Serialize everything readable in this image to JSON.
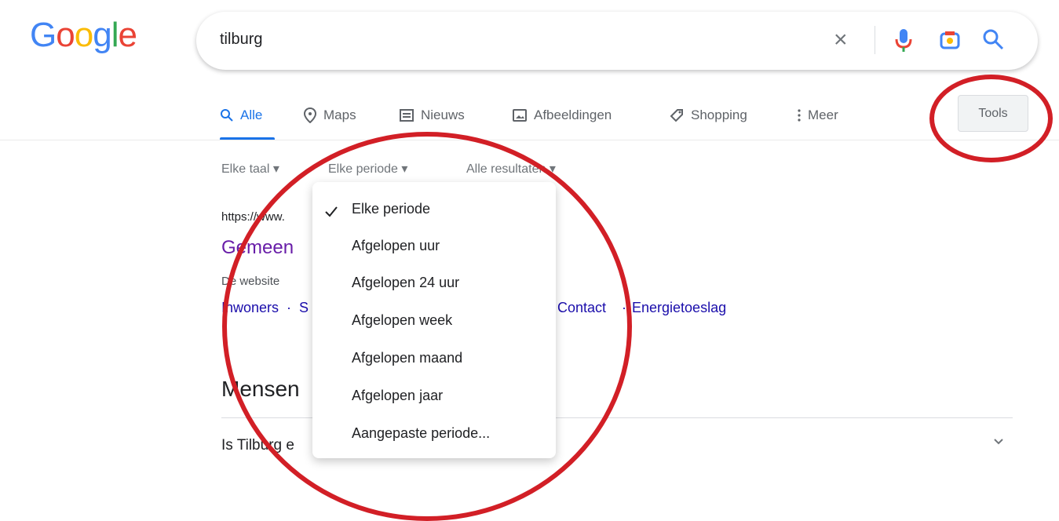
{
  "brand": {
    "logo_letters": [
      "G",
      "o",
      "o",
      "g",
      "l",
      "e"
    ],
    "logo_colors": [
      "#4285F4",
      "#EA4335",
      "#FBBC05",
      "#4285F4",
      "#34A853",
      "#EA4335"
    ]
  },
  "search": {
    "query": "tilburg",
    "clear_icon": "close-icon",
    "voice_icon": "mic-icon",
    "lens_icon": "camera-icon",
    "search_icon": "search-icon"
  },
  "tabs": [
    {
      "label": "Alle",
      "icon": "search-icon",
      "active": true
    },
    {
      "label": "Maps",
      "icon": "pin-icon",
      "active": false
    },
    {
      "label": "Nieuws",
      "icon": "news-icon",
      "active": false
    },
    {
      "label": "Afbeeldingen",
      "icon": "image-icon",
      "active": false
    },
    {
      "label": "Shopping",
      "icon": "tag-icon",
      "active": false
    },
    {
      "label": "Meer",
      "icon": "more-vert-icon",
      "active": false
    }
  ],
  "tools": {
    "label": "Tools"
  },
  "filters": [
    {
      "label": "Elke taal ▾"
    },
    {
      "label": "Elke periode ▾"
    },
    {
      "label": "Alle resultaten ▾"
    }
  ],
  "result": {
    "url": "https://www.",
    "title": "Gemeen",
    "desc": "De website",
    "links": [
      "Inwoners",
      "S",
      "Contact",
      "Energietoeslag"
    ],
    "link_separator": "·"
  },
  "people_title": "Mensen",
  "faq_item": "Is Tilburg e",
  "period_menu": {
    "selected": "Elke periode",
    "items": [
      "Elke periode",
      "Afgelopen uur",
      "Afgelopen 24 uur",
      "Afgelopen week",
      "Afgelopen maand",
      "Afgelopen jaar",
      "Aangepaste periode..."
    ]
  },
  "annotation_color": "#d21f26"
}
